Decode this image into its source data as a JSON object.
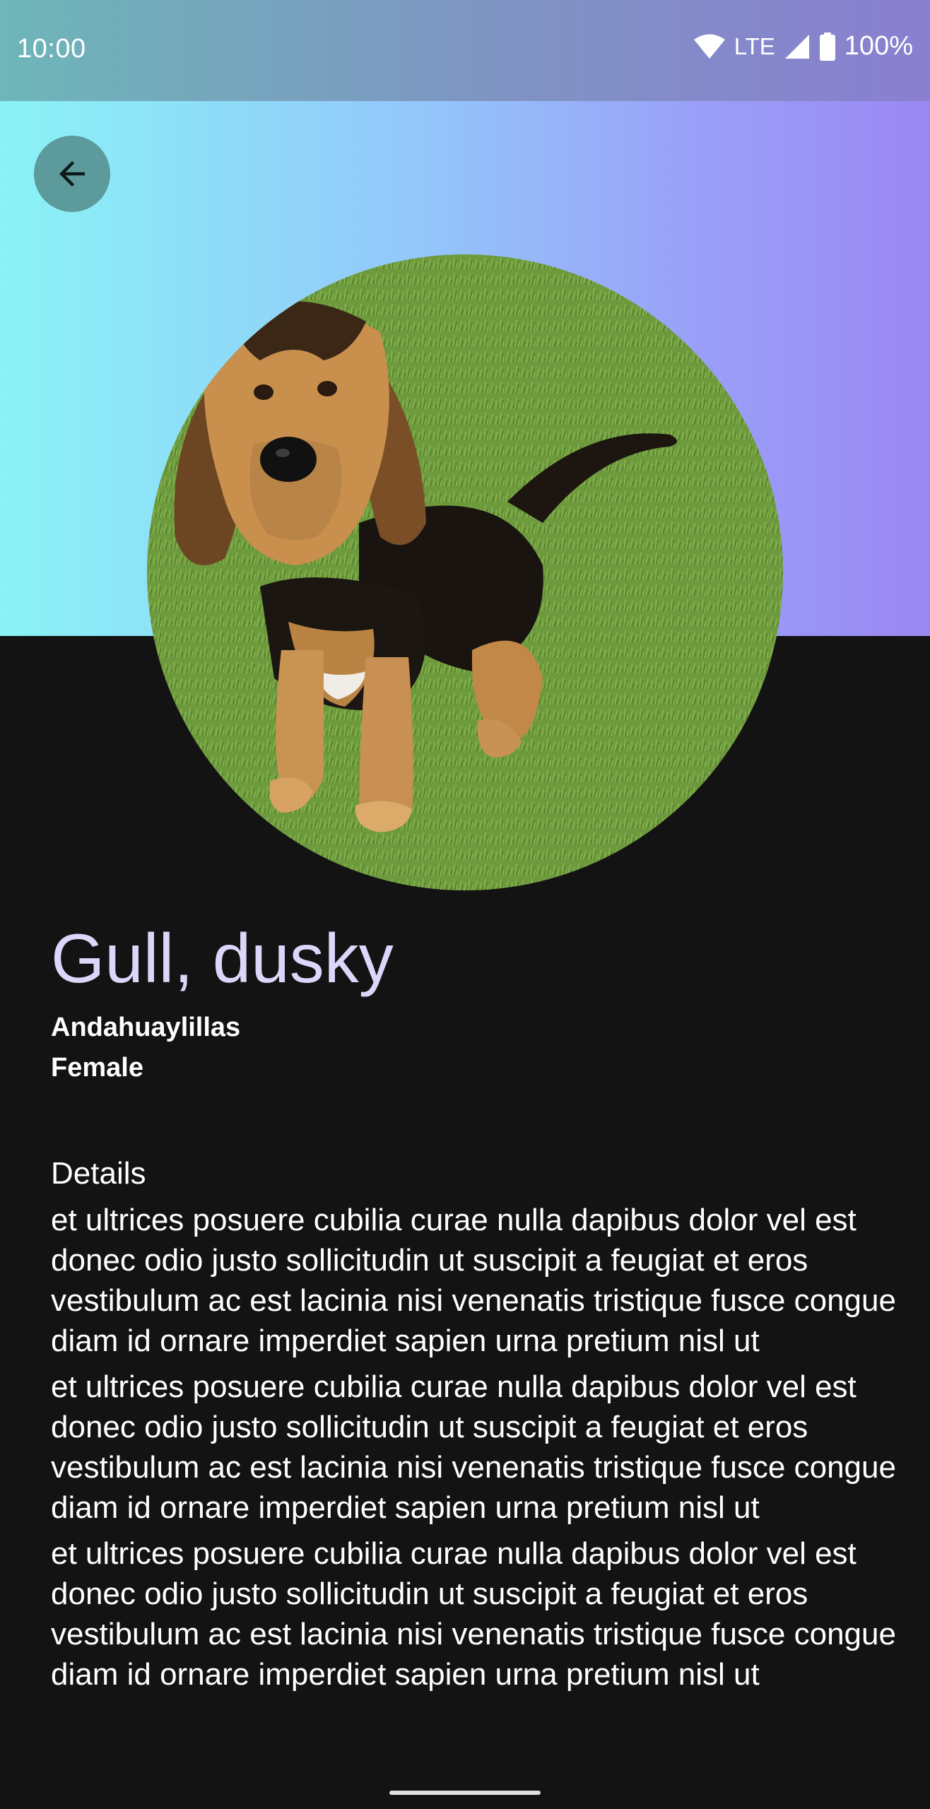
{
  "status_bar": {
    "time": "10:00",
    "network": "LTE",
    "battery": "100%"
  },
  "pet": {
    "name": "Gull, dusky",
    "location": "Andahuaylillas",
    "gender": "Female"
  },
  "details": {
    "heading": "Details",
    "paragraphs": [
      "et ultrices posuere cubilia curae nulla dapibus dolor vel est donec odio justo sollicitudin ut suscipit a feugiat et eros vestibulum ac est lacinia nisi venenatis tristique fusce congue diam id ornare imperdiet sapien urna pretium nisl ut",
      "et ultrices posuere cubilia curae nulla dapibus dolor vel est donec odio justo sollicitudin ut suscipit a feugiat et eros vestibulum ac est lacinia nisi venenatis tristique fusce congue diam id ornare imperdiet sapien urna pretium nisl ut",
      "et ultrices posuere cubilia curae nulla dapibus dolor vel est donec odio justo sollicitudin ut suscipit a feugiat et eros vestibulum ac est lacinia nisi venenatis tristique fusce congue diam id ornare imperdiet sapien urna pretium nisl ut"
    ]
  },
  "icons": {
    "back": "arrow-back-icon",
    "wifi": "wifi-icon",
    "signal": "cell-signal-icon",
    "battery": "battery-icon",
    "photo": "dog-photo"
  },
  "colors": {
    "name_text": "#dcd6fa",
    "background": "#131313",
    "back_button": "#5d9a9c"
  }
}
